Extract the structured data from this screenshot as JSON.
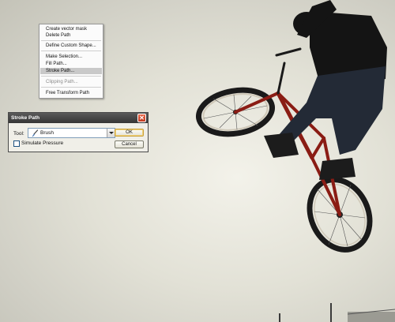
{
  "context_menu": {
    "items": [
      {
        "label": "Create vector mask",
        "disabled": false
      },
      {
        "label": "Delete Path",
        "disabled": false
      },
      {
        "label": "Define Custom Shape...",
        "disabled": false
      },
      {
        "label": "Make Selection...",
        "disabled": false
      },
      {
        "label": "Fill Path...",
        "disabled": false
      },
      {
        "label": "Stroke Path...",
        "disabled": false,
        "highlighted": true
      },
      {
        "label": "Clipping Path...",
        "disabled": true
      },
      {
        "label": "Free Transform Path",
        "disabled": false
      }
    ]
  },
  "dialog": {
    "title": "Stroke Path",
    "close_glyph": "✕",
    "tool_label": "Tool:",
    "tool_value": "Brush",
    "simulate_pressure_label": "Simulate Pressure",
    "simulate_pressure_checked": false,
    "ok_label": "OK",
    "cancel_label": "Cancel"
  },
  "icons": {
    "brush": "brush-icon",
    "close": "close-icon",
    "dropdown": "chevron-down-icon"
  },
  "colors": {
    "sky": "#e2e1d6",
    "bike_frame": "#8a1c14",
    "title_bar": "#404040",
    "close_button": "#d2492a",
    "menu_highlight": "#c9c9c9"
  }
}
